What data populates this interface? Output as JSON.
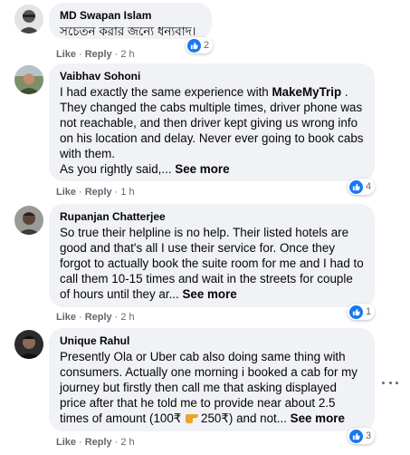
{
  "comments": [
    {
      "author": "MD Swapan Islam",
      "text": "সচেতন করার জন্যে ধন্যবাদ।",
      "like": "Like",
      "reply": "Reply",
      "time": "2 h",
      "reaction_count": "2"
    },
    {
      "author": "Vaibhav Sohoni",
      "text_pre": "I had exactly the same experience with ",
      "text_bold": "MakeMyTrip",
      "text_post": " . They changed the cabs multiple times, driver phone was not reachable, and then driver kept giving us wrong info on his location and delay. Never ever going to book cabs with them.",
      "text_line2": "As you rightly said,... ",
      "see_more": "See more",
      "like": "Like",
      "reply": "Reply",
      "time": "1 h",
      "reaction_count": "4"
    },
    {
      "author": "Rupanjan Chatterjee",
      "text": "So true their helpline is no help. Their listed hotels are good and that's all I use their service for. Once they forgot to actually book the suite room for me and I had to call them 10-15 times and wait in the streets for couple of hours until they ar... ",
      "see_more": "See more",
      "like": "Like",
      "reply": "Reply",
      "time": "2 h",
      "reaction_count": "1"
    },
    {
      "author": "Unique Rahul",
      "text_pre": "Presently Ola or Uber cab also doing same thing with consumers. Actually one morning i booked a cab for my journey but firstly then call me that asking displayed price after that he told me to provide near about 2.5 times of amount (100₹ ",
      "text_post": "250₹) and not... ",
      "see_more": "See more",
      "like": "Like",
      "reply": "Reply",
      "time": "2 h",
      "reaction_count": "3"
    }
  ]
}
